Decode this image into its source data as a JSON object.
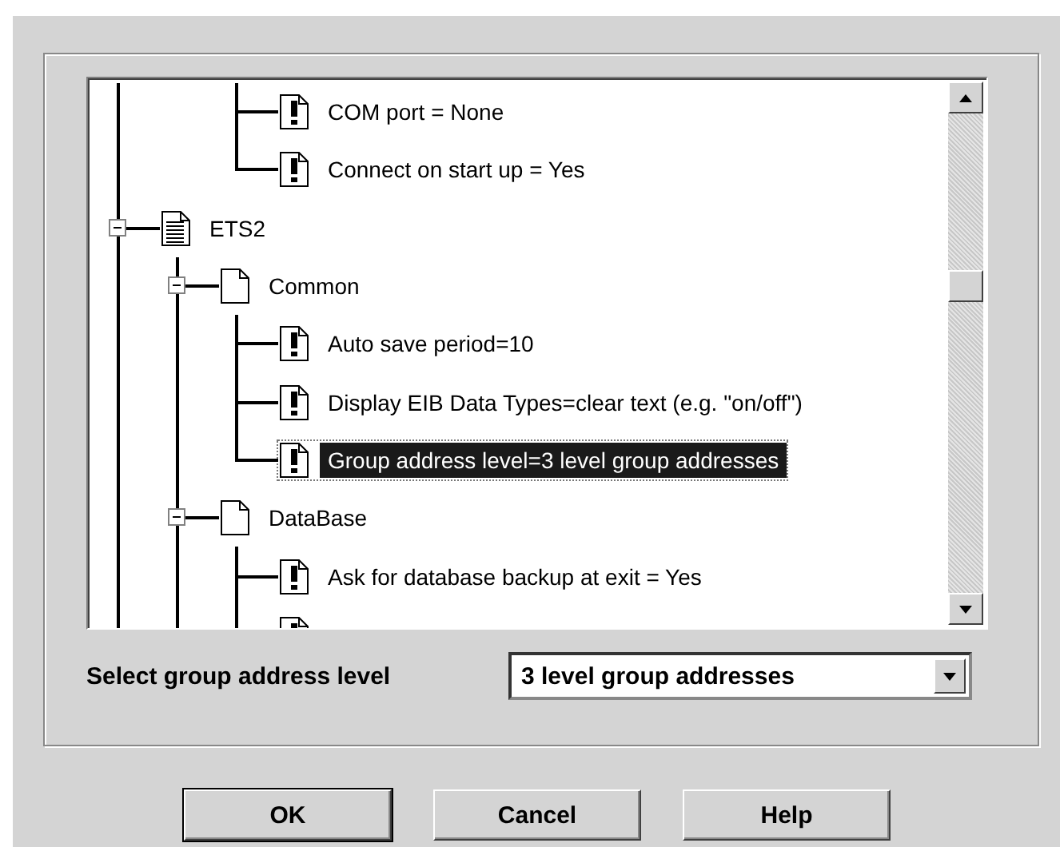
{
  "tree": {
    "continues": true,
    "items": [
      {
        "kind": "hidden",
        "children": [
          {
            "kind": "hidden",
            "children": [
              {
                "kind": "setting",
                "label": "COM port = None",
                "selected": false
              },
              {
                "kind": "setting",
                "label": "Connect on start up = Yes",
                "selected": false
              }
            ]
          }
        ]
      },
      {
        "kind": "document",
        "label": "ETS2",
        "expanded": true,
        "selected": false,
        "children": [
          {
            "kind": "page",
            "label": "Common",
            "expanded": true,
            "selected": false,
            "children": [
              {
                "kind": "setting",
                "label": "Auto save period=10",
                "selected": false
              },
              {
                "kind": "setting",
                "label": "Display EIB Data Types=clear text (e.g. \"on/off\")",
                "selected": false
              },
              {
                "kind": "setting",
                "label": "Group address level=3 level group addresses",
                "selected": true
              }
            ]
          },
          {
            "kind": "page",
            "label": "DataBase",
            "expanded": true,
            "selected": false,
            "children_continue": true,
            "children": [
              {
                "kind": "setting",
                "label": "Ask for database backup at exit = Yes",
                "selected": false
              },
              {
                "kind": "setting",
                "selected": false
              }
            ]
          }
        ],
        "children_continue": true
      }
    ]
  },
  "level_select": {
    "label": "Select group address level",
    "value": "3 level group addresses"
  },
  "buttons": [
    {
      "label": "OK",
      "default": true
    },
    {
      "label": "Cancel",
      "default": false
    },
    {
      "label": "Help",
      "default": false
    }
  ]
}
